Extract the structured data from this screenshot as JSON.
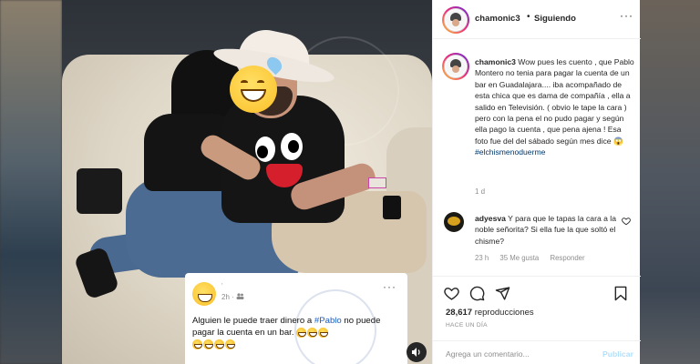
{
  "post": {
    "fb_card": {
      "time": "2h · ",
      "text_before": "Alguien le puede traer dinero a ",
      "link": "#Pablo",
      "text_after": " no puede pagar la cuenta en un bar."
    }
  },
  "header": {
    "username": "chamonic3",
    "dot": "•",
    "follow_label": "Siguiendo",
    "more": "···"
  },
  "caption": {
    "username": "chamonic3",
    "text": " Wow pues les cuento , que Pablo Montero no tenia para pagar la cuenta de un bar en Guadalajara.... iba acompañado de esta chica que es dama de compañía , ella a salido en Televisión. ( obvio le tape la cara ) pero con la pena el no pudo pagar y según ella pago la cuenta , que pena ajena ! Esa foto fue del del sábado según mes dice ",
    "hashtag": "#elchismenoduerme",
    "time": "1 d"
  },
  "comment": {
    "username": "adyesva",
    "text": " Y para que le tapas la cara a la noble señorita? Si ella fue la que soltó el chisme?",
    "time": "23 h",
    "likes": "35 Me gusta",
    "reply": "Responder"
  },
  "stats": {
    "views": "28,617",
    "views_label": " reproducciones",
    "ago": "HACE UN DÍA"
  },
  "comment_box": {
    "placeholder": "Agrega un comentario...",
    "post_label": "Publicar"
  }
}
